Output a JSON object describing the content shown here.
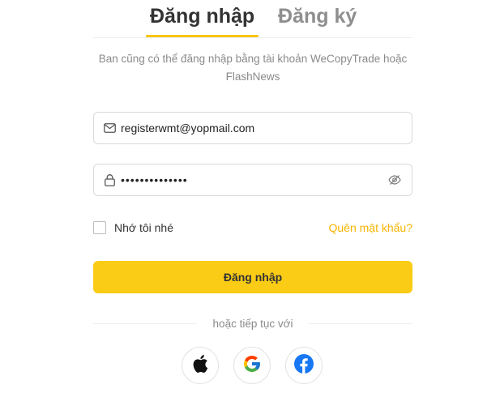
{
  "tabs": {
    "login": "Đăng nhập",
    "register": "Đăng ký"
  },
  "subtitle": "Ban cũng có thể đăng nhập bằng tài khoản WeCopyTrade hoặc FlashNews",
  "email": {
    "value": "registerwmt@yopmail.com",
    "icon": "mail-icon"
  },
  "password": {
    "value": "••••••••••••••",
    "icon": "lock-icon",
    "toggle_icon": "eye-off-icon"
  },
  "remember": {
    "label": "Nhớ tôi nhé",
    "checked": false
  },
  "forgot_label": "Quên mật khẩu?",
  "submit_label": "Đăng nhập",
  "divider_text": "hoặc tiếp tục với",
  "social": [
    "apple-icon",
    "google-icon",
    "facebook-icon"
  ],
  "colors": {
    "accent": "#facc15",
    "link": "#f7b500",
    "facebook": "#1877f2"
  }
}
